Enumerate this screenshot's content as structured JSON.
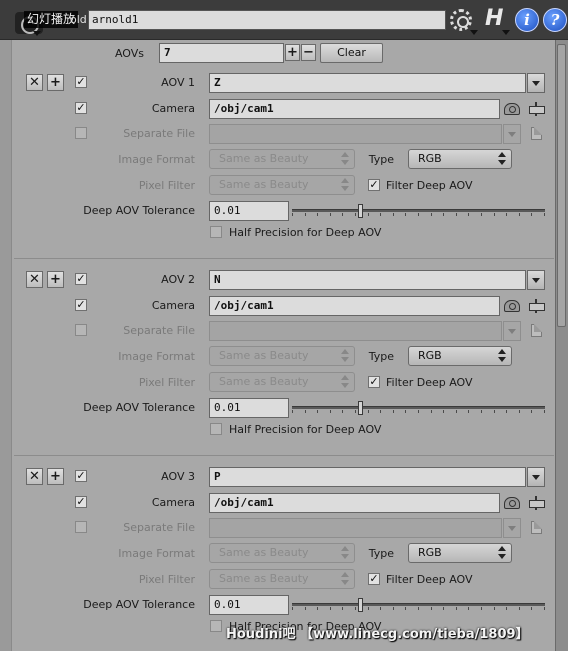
{
  "header": {
    "overlay_label": "幻灯播放",
    "name_label": "old",
    "name_value": "arnold1",
    "help_icon": "info-icon",
    "colors": {
      "header_bg": "#3c3c3c",
      "panel_bg": "#a8a8a8",
      "accent_blue": "#1d4fc0"
    }
  },
  "aovs": {
    "label": "AOVs",
    "count": "7",
    "plus": "+",
    "minus": "−",
    "clear_label": "Clear"
  },
  "labels": {
    "camera": "Camera",
    "separate_file": "Separate File",
    "image_format": "Image Format",
    "pixel_filter": "Pixel Filter",
    "type": "Type",
    "filter_deep": "Filter Deep AOV",
    "deep_tolerance": "Deep AOV Tolerance",
    "half_precision": "Half Precision for Deep AOV",
    "remove": "✕",
    "insert": "+",
    "check": "✓"
  },
  "blocks": [
    {
      "aov_label": "AOV 1",
      "aov_value": "Z",
      "camera": "/obj/cam1",
      "separate_file": "",
      "image_format": "Same as Beauty",
      "pixel_filter": "Same as Beauty",
      "type": "RGB",
      "tolerance": "0.01",
      "tolerance_slider_fraction": 0.27
    },
    {
      "aov_label": "AOV 2",
      "aov_value": "N",
      "camera": "/obj/cam1",
      "separate_file": "",
      "image_format": "Same as Beauty",
      "pixel_filter": "Same as Beauty",
      "type": "RGB",
      "tolerance": "0.01",
      "tolerance_slider_fraction": 0.27
    },
    {
      "aov_label": "AOV 3",
      "aov_value": "P",
      "camera": "/obj/cam1",
      "separate_file": "",
      "image_format": "Same as Beauty",
      "pixel_filter": "Same as Beauty",
      "type": "RGB",
      "tolerance": "0.01",
      "tolerance_slider_fraction": 0.27
    }
  ],
  "watermark": "Houdini吧 【www.linecg.com/tieba/1809】"
}
